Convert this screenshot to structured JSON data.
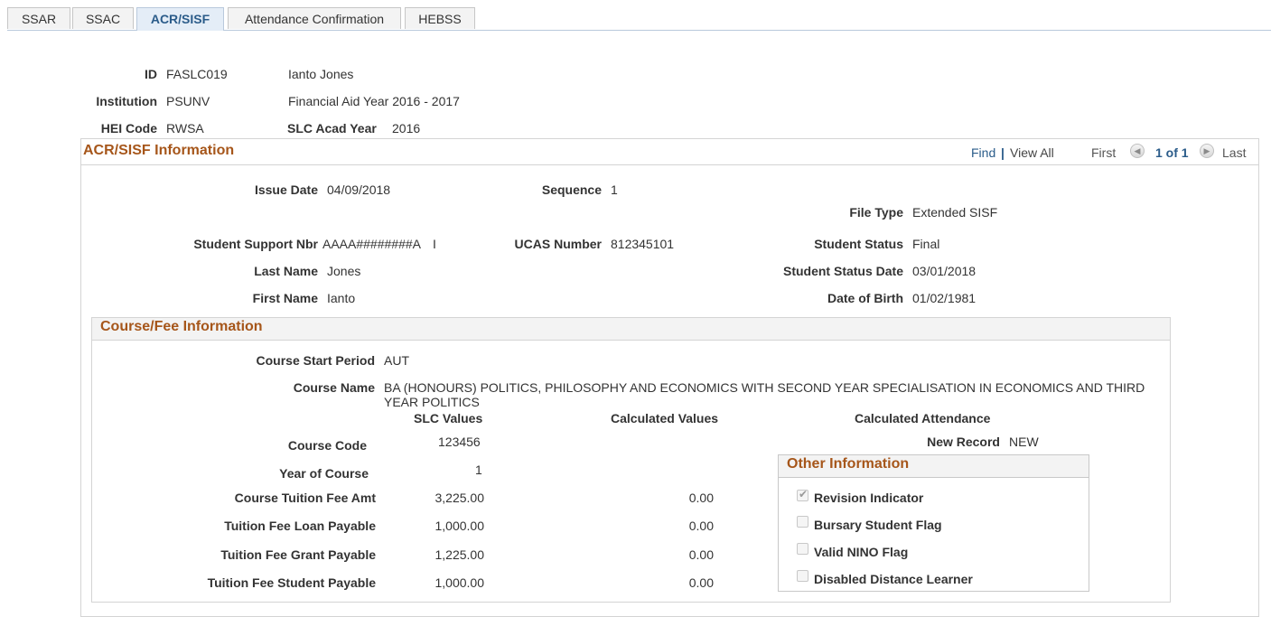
{
  "tabs": [
    {
      "label": "SSAR"
    },
    {
      "label": "SSAC"
    },
    {
      "label": "ACR/SISF"
    },
    {
      "label": "Attendance Confirmation"
    },
    {
      "label": "HEBSS"
    }
  ],
  "header": {
    "id_label": "ID",
    "id_value": "FASLC019",
    "name": "Ianto Jones",
    "institution_label": "Institution",
    "institution_value": "PSUNV",
    "aid_year": "Financial Aid Year 2016 - 2017",
    "hei_label": "HEI Code",
    "hei_value": "RWSA",
    "slc_year_label": "SLC Acad Year",
    "slc_year_value": "2016"
  },
  "acr": {
    "title": "ACR/SISF Information",
    "nav": {
      "find": "Find",
      "sep": "|",
      "view_all": "View All",
      "first": "First",
      "count": "1 of 1",
      "last": "Last"
    },
    "issue_date_label": "Issue Date",
    "issue_date": "04/09/2018",
    "sequence_label": "Sequence",
    "sequence": "1",
    "file_type_label": "File Type",
    "file_type": "Extended SISF",
    "support_nbr_label": "Student Support Nbr",
    "support_nbr": "AAAA########A",
    "support_nbr_suffix": "I",
    "ucas_label": "UCAS Number",
    "ucas": "812345101",
    "status_label": "Student Status",
    "status": "Final",
    "last_name_label": "Last Name",
    "last_name": "Jones",
    "status_date_label": "Student Status Date",
    "status_date": "03/01/2018",
    "first_name_label": "First Name",
    "first_name": "Ianto",
    "dob_label": "Date of Birth",
    "dob": "01/02/1981"
  },
  "course": {
    "title": "Course/Fee Information",
    "start_period_label": "Course Start Period",
    "start_period": "AUT",
    "name_label": "Course Name",
    "name": "BA (HONOURS) POLITICS, PHILOSOPHY AND ECONOMICS WITH SECOND YEAR SPECIALISATION IN ECONOMICS AND THIRD YEAR POLITICS",
    "col_slc": "SLC Values",
    "col_calc": "Calculated Values",
    "col_att": "Calculated Attendance",
    "code_label": "Course Code",
    "code": "123456",
    "new_record_label": "New Record",
    "new_record": "NEW",
    "year_label": "Year of Course",
    "year": "1",
    "rows": [
      {
        "label": "Course Tuition Fee Amt",
        "slc": "3,225.00",
        "calc": "0.00"
      },
      {
        "label": "Tuition Fee Loan Payable",
        "slc": "1,000.00",
        "calc": "0.00"
      },
      {
        "label": "Tuition Fee Grant Payable",
        "slc": "1,225.00",
        "calc": "0.00"
      },
      {
        "label": "Tuition Fee Student Payable",
        "slc": "1,000.00",
        "calc": "0.00"
      }
    ]
  },
  "other": {
    "title": "Other Information",
    "checks": [
      {
        "label": "Revision Indicator",
        "checked": true
      },
      {
        "label": "Bursary Student Flag",
        "checked": false
      },
      {
        "label": "Valid NINO Flag",
        "checked": false
      },
      {
        "label": "Disabled Distance Learner",
        "checked": false
      }
    ]
  },
  "icons": {
    "prev": "prev-arrow-icon",
    "next": "next-arrow-icon",
    "check": "checkmark-icon"
  }
}
